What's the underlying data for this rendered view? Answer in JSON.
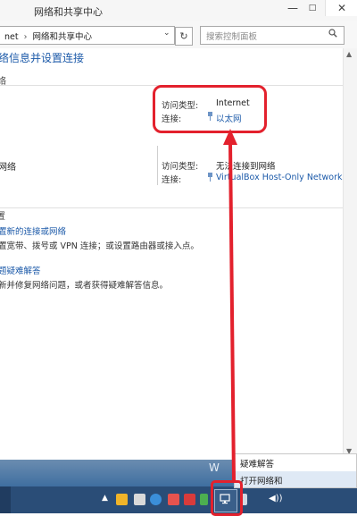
{
  "window": {
    "title": "网络和共享中心",
    "minimize": "—",
    "maximize": "□",
    "close": "✕"
  },
  "address": {
    "path_prev": "net",
    "separator": "›",
    "path_current": "网络和共享中心",
    "dropdown": "⌄",
    "refresh": "↻",
    "search_placeholder": "搜索控制面板"
  },
  "main": {
    "heading": "络信息并设置连接",
    "section1_title": "络",
    "network1": {
      "access_type_label": "访问类型:",
      "access_type_value": "Internet",
      "connection_label": "连接:",
      "connection_value": "以太网"
    },
    "network2": {
      "name": "网络",
      "access_type_label": "访问类型:",
      "access_type_value": "无法连接到网络",
      "connection_label": "连接:",
      "connection_value": "VirtualBox Host-Only Network"
    },
    "section2_title": "置",
    "action1_link": "置新的连接或网络",
    "action1_desc": "置宽带、拨号或 VPN 连接；或设置路由器或接入点。",
    "action2_link": "题疑难解答",
    "action2_desc": "新并修复网络问题，或者获得疑难解答信息。"
  },
  "scrollbar": {
    "up": "▲",
    "down": "▼"
  },
  "desktop": {
    "glyph": "W"
  },
  "taskbar": {
    "tray_up": "▲",
    "volume": "◀))"
  },
  "context_menu": {
    "items": [
      "疑难解答",
      "打开网络和"
    ]
  },
  "colors": {
    "annotation": "#e3212d",
    "link": "#1c5aa9",
    "taskbar": "#2a4d77"
  }
}
